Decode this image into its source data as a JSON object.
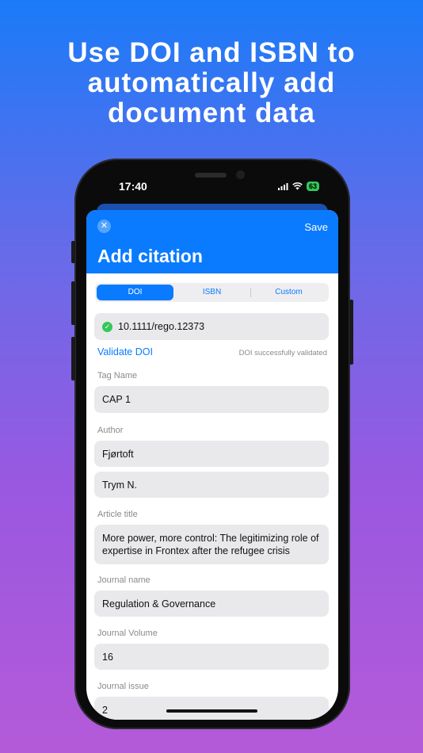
{
  "headline": [
    "Use DOI and ISBN to",
    "automatically add",
    "document data"
  ],
  "status": {
    "time": "17:40",
    "battery": "63"
  },
  "sheet": {
    "close_icon": "close-icon",
    "save_label": "Save",
    "title": "Add citation"
  },
  "tabs": [
    {
      "label": "DOI",
      "active": true
    },
    {
      "label": "ISBN",
      "active": false
    },
    {
      "label": "Custom",
      "active": false
    }
  ],
  "doi": {
    "value": "10.1111/rego.12373",
    "validate_label": "Validate DOI",
    "status_text": "DOI successfully validated"
  },
  "fields": {
    "tag_name": {
      "label": "Tag Name",
      "value": "CAP 1"
    },
    "author": {
      "label": "Author",
      "last_name": "Fjørtoft",
      "first_name": "Trym N."
    },
    "article_title": {
      "label": "Article title",
      "value": "More power, more control: The legitimizing role of expertise in Frontex after the refugee crisis"
    },
    "journal_name": {
      "label": "Journal name",
      "value": "Regulation & Governance"
    },
    "journal_volume": {
      "label": "Journal Volume",
      "value": "16"
    },
    "journal_issue": {
      "label": "Journal issue",
      "value": "2"
    }
  },
  "colors": {
    "accent": "#0a7bfe",
    "success": "#34c759"
  }
}
